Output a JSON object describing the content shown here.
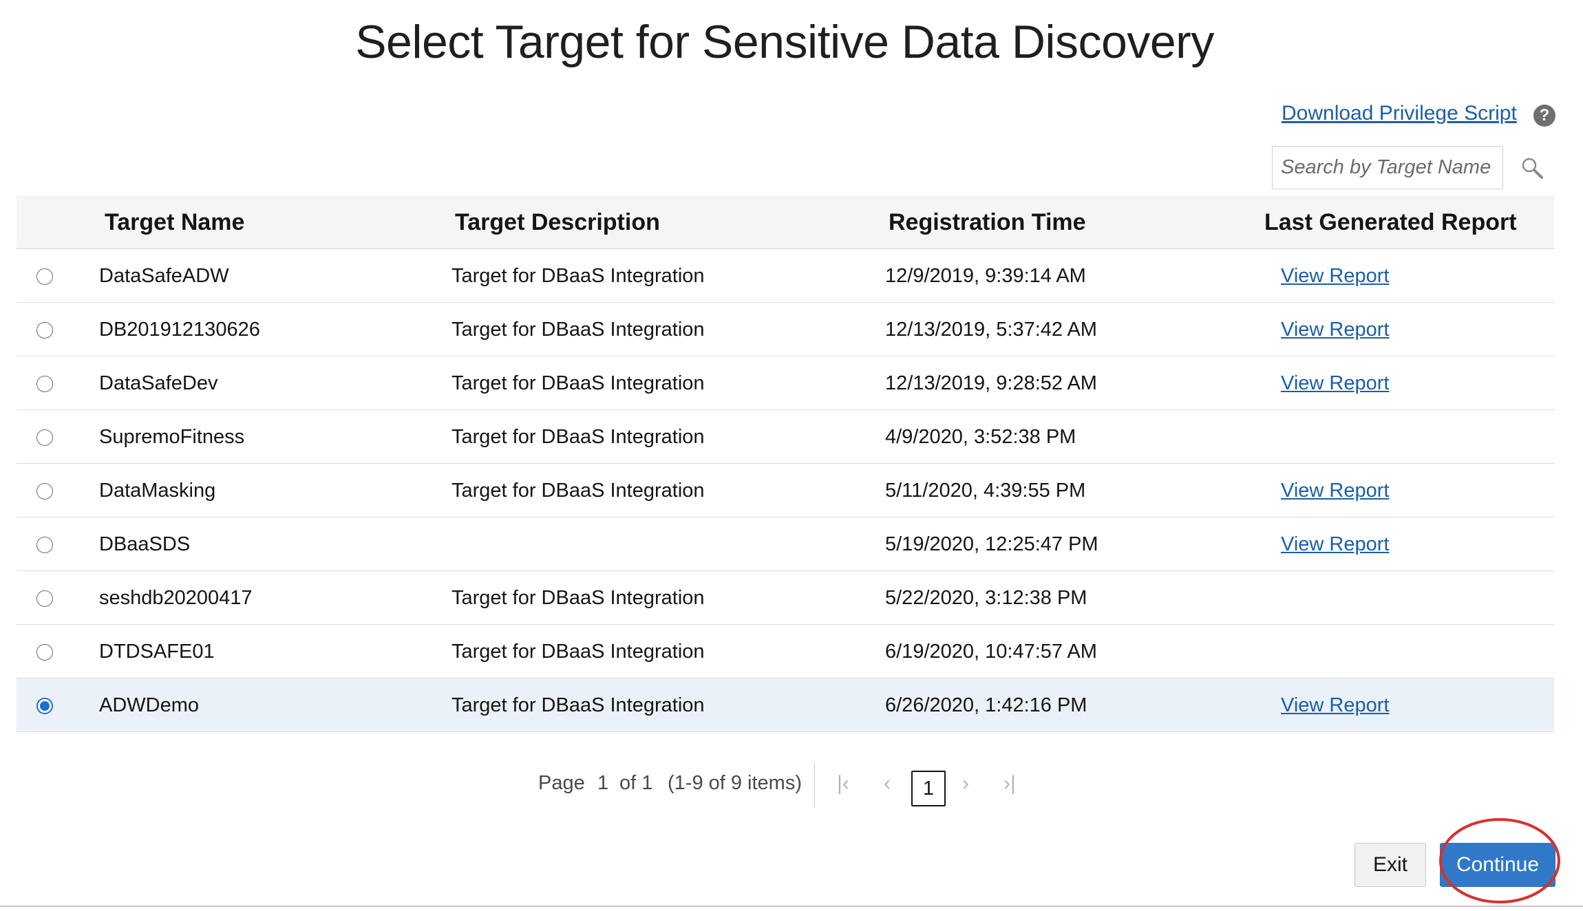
{
  "title": "Select Target for Sensitive Data Discovery",
  "download_link": "Download Privilege Script",
  "help_icon": "question-mark-icon",
  "search": {
    "placeholder": "Search by Target Name"
  },
  "table": {
    "headers": [
      "Target Name",
      "Target Description",
      "Registration Time",
      "Last Generated Report"
    ],
    "rows": [
      {
        "name": "DataSafeADW",
        "description": "Target for DBaaS Integration",
        "time": "12/9/2019, 9:39:14 AM",
        "report": "View Report",
        "selected": false
      },
      {
        "name": "DB201912130626",
        "description": "Target for DBaaS Integration",
        "time": "12/13/2019, 5:37:42 AM",
        "report": "View Report",
        "selected": false
      },
      {
        "name": "DataSafeDev",
        "description": "Target for DBaaS Integration",
        "time": "12/13/2019, 9:28:52 AM",
        "report": "View Report",
        "selected": false
      },
      {
        "name": "SupremoFitness",
        "description": "Target for DBaaS Integration",
        "time": "4/9/2020, 3:52:38 PM",
        "report": "",
        "selected": false
      },
      {
        "name": "DataMasking",
        "description": "Target for DBaaS Integration",
        "time": "5/11/2020, 4:39:55 PM",
        "report": "View Report",
        "selected": false
      },
      {
        "name": "DBaaSDS",
        "description": "",
        "time": "5/19/2020, 12:25:47 PM",
        "report": "View Report",
        "selected": false
      },
      {
        "name": "seshdb20200417",
        "description": "Target for DBaaS Integration",
        "time": "5/22/2020, 3:12:38 PM",
        "report": "",
        "selected": false
      },
      {
        "name": "DTDSAFE01",
        "description": "Target for DBaaS Integration",
        "time": "6/19/2020, 10:47:57 AM",
        "report": "",
        "selected": false
      },
      {
        "name": "ADWDemo",
        "description": "Target for DBaaS Integration",
        "time": "6/26/2020, 1:42:16 PM",
        "report": "View Report",
        "selected": true
      }
    ]
  },
  "pagination": {
    "page_label": "Page",
    "current_page": "1",
    "of_label": "of 1",
    "items_label": "(1-9 of 9 items)",
    "page_button": "1"
  },
  "buttons": {
    "exit": "Exit",
    "continue": "Continue"
  },
  "colors": {
    "accent": "#2f79c8",
    "link": "#1a5ea8",
    "selected_row": "#eaf1f8",
    "highlight_ring": "#d9302c"
  }
}
